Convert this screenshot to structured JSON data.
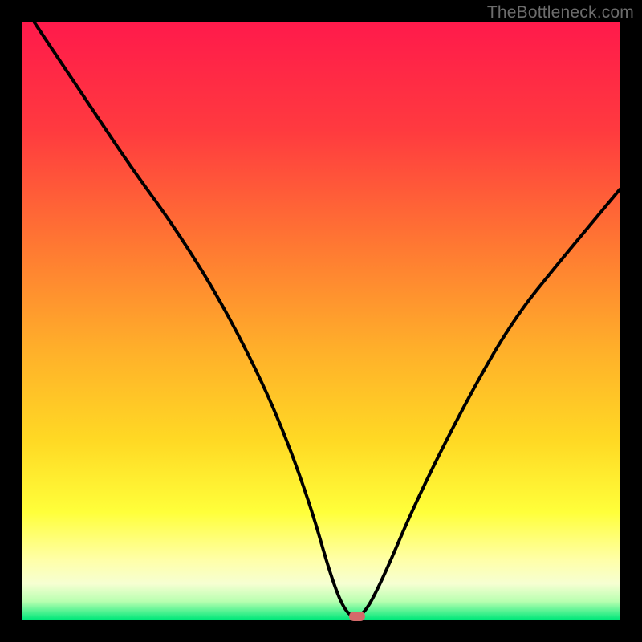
{
  "watermark": "TheBottleneck.com",
  "colors": {
    "background": "#000000",
    "curve_stroke": "#000000",
    "marker_fill": "#d46a6a"
  },
  "chart_data": {
    "type": "line",
    "title": "",
    "xlabel": "",
    "ylabel": "",
    "xlim": [
      0,
      100
    ],
    "ylim": [
      0,
      100
    ],
    "gradient_stops": [
      {
        "pct": 0,
        "color": "#ff1a4b"
      },
      {
        "pct": 18,
        "color": "#ff3a3f"
      },
      {
        "pct": 38,
        "color": "#ff7a32"
      },
      {
        "pct": 55,
        "color": "#ffb02a"
      },
      {
        "pct": 70,
        "color": "#ffd924"
      },
      {
        "pct": 82,
        "color": "#ffff3a"
      },
      {
        "pct": 90,
        "color": "#ffffa8"
      },
      {
        "pct": 94,
        "color": "#f6ffd2"
      },
      {
        "pct": 97,
        "color": "#b8ffb0"
      },
      {
        "pct": 100,
        "color": "#00e87a"
      }
    ],
    "series": [
      {
        "name": "bottleneck-curve",
        "x": [
          2,
          10,
          18,
          26,
          34,
          42,
          48,
          52,
          54.5,
          57,
          60,
          66,
          74,
          82,
          90,
          100
        ],
        "y": [
          100,
          88,
          76,
          65,
          52,
          36,
          20,
          6,
          0.5,
          0.5,
          6,
          20,
          36,
          50,
          60,
          72
        ]
      }
    ],
    "minimum_marker": {
      "x": 56,
      "y": 0.5
    }
  }
}
